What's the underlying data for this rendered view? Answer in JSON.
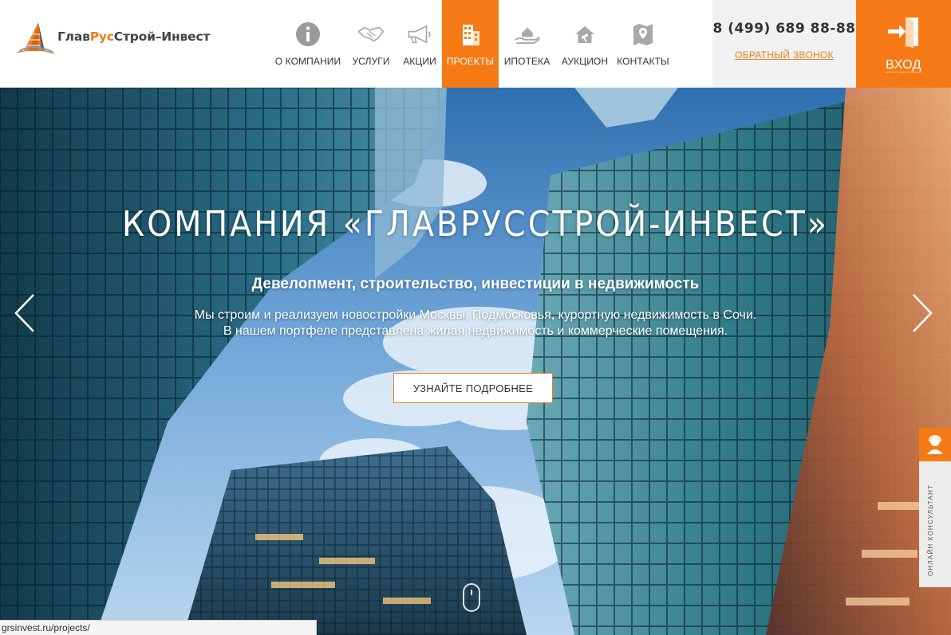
{
  "logo": {
    "part1": "Глав",
    "part2": "Рус",
    "part3": "Строй–Инвест",
    "icon": "building-logo-icon"
  },
  "nav": {
    "items": [
      {
        "label": "О компании",
        "icon": "info-icon"
      },
      {
        "label": "Услуги",
        "icon": "handshake-icon"
      },
      {
        "label": "Акции",
        "icon": "megaphone-icon"
      },
      {
        "label": "Проекты",
        "icon": "building-icon",
        "active": true
      },
      {
        "label": "Ипотека",
        "icon": "house-hand-icon"
      },
      {
        "label": "Аукцион",
        "icon": "house-gavel-icon"
      },
      {
        "label": "Контакты",
        "icon": "map-pin-icon"
      }
    ]
  },
  "contact": {
    "phone": "8 (499) 689 88-88",
    "callback": "Обратный звонок"
  },
  "login": {
    "label": "Вход",
    "icon": "login-door-icon"
  },
  "hero": {
    "title": "Компания «ГлавРусСтрой-Инвест»",
    "subtitle": "Девелопмент, строительство, инвестиции в недвижимость",
    "description_line1": "Мы строим и реализуем новостройки Москвы, Подмосковья, курортную недвижимость в Сочи.",
    "description_line2": "В нашем портфеле представлена жилая недвижимость и коммерческие помещения.",
    "button": "Узнайте подробнее"
  },
  "consultant": {
    "label": "Онлайн консультант",
    "icon": "consultant-icon"
  },
  "status_url": "grsinvest.ru/projects/",
  "colors": {
    "accent": "#f57a15",
    "text": "#333333"
  }
}
